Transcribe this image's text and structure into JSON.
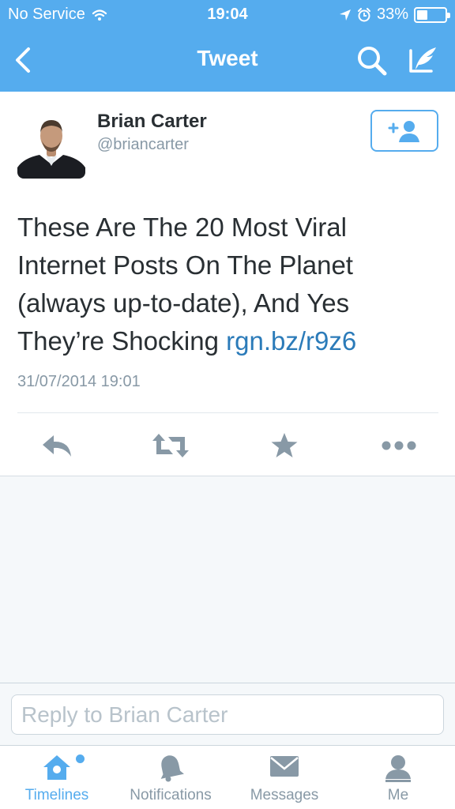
{
  "status_bar": {
    "carrier": "No Service",
    "time": "19:04",
    "battery_percent": "33%",
    "battery_level": 0.33
  },
  "nav": {
    "title": "Tweet",
    "back_icon": "chevron-left-icon",
    "search_icon": "search-icon",
    "compose_icon": "compose-icon"
  },
  "tweet": {
    "author_name": "Brian Carter",
    "author_handle": "@briancarter",
    "text": "These Are The 20 Most Viral Internet Posts On The Planet (always up-to-date), And Yes They’re Shocking ",
    "link": "rgn.bz/r9z6",
    "timestamp": "31/07/2014 19:01",
    "follow_icon": "add-user-icon",
    "actions": [
      "reply-icon",
      "retweet-icon",
      "favorite-icon",
      "more-icon"
    ]
  },
  "reply": {
    "placeholder": "Reply to Brian Carter",
    "value": ""
  },
  "tabs": [
    {
      "label": "Timelines",
      "icon": "home-icon",
      "active": true
    },
    {
      "label": "Notifications",
      "icon": "bell-icon",
      "active": false
    },
    {
      "label": "Messages",
      "icon": "envelope-icon",
      "active": false
    },
    {
      "label": "Me",
      "icon": "person-icon",
      "active": false
    }
  ],
  "colors": {
    "brand": "#55acee",
    "link": "#2b7bb9",
    "text": "#292f33",
    "muted": "#8899a6"
  }
}
